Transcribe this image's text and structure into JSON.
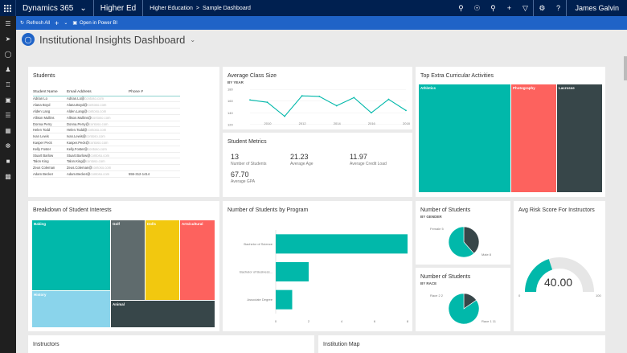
{
  "nav": {
    "brand": "Dynamics 365",
    "app": "Higher Ed",
    "crumb_root": "Higher Education",
    "crumb_sep": ">",
    "crumb_page": "Sample Dashboard",
    "user": "James Galvin"
  },
  "cmd": {
    "refresh": "Refresh All",
    "powerbi": "Open in Power BI"
  },
  "header": {
    "title": "Institutional Insights Dashboard"
  },
  "students": {
    "title": "Students",
    "columns": [
      "Student Name",
      "Email Address",
      "Phone #"
    ],
    "rows": [
      [
        "Adrian Lo",
        "Adrian.Lo@",
        "contoso.com",
        ""
      ],
      [
        "Alana Boyd",
        "Alana.Boyd@",
        "contoso.com",
        ""
      ],
      [
        "Alden Lang",
        "Alden.Lang@",
        "contoso.com",
        ""
      ],
      [
        "Allison Mullins",
        "Allison.Mullins@",
        "contoso.com",
        ""
      ],
      [
        "Donna Perry",
        "Donna.Perry@",
        "contoso.com",
        ""
      ],
      [
        "Helen Todd",
        "Helen.Todd@",
        "contoso.com",
        ""
      ],
      [
        "Ivan Lewis",
        "Ivan.Lewis@",
        "contoso.com",
        ""
      ],
      [
        "Kasper Peck",
        "Kasper.Peck@",
        "contoso.com",
        ""
      ],
      [
        "Kelly Foster",
        "Kelly.Foster@",
        "contoso.com",
        ""
      ],
      [
        "Stuart Barlow",
        "Stuart.Barlow@",
        "contoso.com",
        ""
      ],
      [
        "Talon King",
        "Talon.King@",
        "contoso.com",
        ""
      ],
      [
        "Zeus Coleman",
        "Zeus.Coleman@",
        "contoso.com",
        ""
      ],
      [
        "Adam Becker",
        "Adam.Becker@",
        "contoso.com",
        "555-312-1414"
      ]
    ]
  },
  "class_size": {
    "title": "Average Class Size",
    "subtitle": "BY YEAR"
  },
  "metrics": {
    "title": "Student Metrics",
    "items": [
      {
        "value": "13",
        "label": "Number of Students"
      },
      {
        "value": "21.23",
        "label": "Average Age"
      },
      {
        "value": "11.97",
        "label": "Average Credit Load"
      },
      {
        "value": "67.70",
        "label": "Average GPA"
      }
    ]
  },
  "extracurricular": {
    "title": "Top Extra Curricular Activities",
    "labels": [
      "Athletics",
      "Photography",
      "Lacrosse"
    ]
  },
  "interests": {
    "title": "Breakdown of Student Interests",
    "labels": [
      "Baking",
      "Golf",
      "Dolls",
      "Arts/cultural",
      "History",
      "Animal"
    ]
  },
  "by_gender": {
    "title": "Number of Students",
    "subtitle": "BY GENDER",
    "labels": [
      "Female 5",
      "Male 8"
    ]
  },
  "by_race": {
    "title": "Number of Students",
    "subtitle": "BY RACE",
    "labels": [
      "Race 2 2",
      "Race 1 11"
    ]
  },
  "risk": {
    "title": "Avg Risk Score For Instructors",
    "value": "40.00",
    "min": "0",
    "max": "100",
    "fraction": 0.4
  },
  "instructors": {
    "title": "Instructors"
  },
  "map": {
    "title": "Institution Map"
  },
  "chart_data": [
    {
      "type": "line",
      "title": "Average Class Size",
      "subtitle": "BY YEAR",
      "x": [
        2009,
        2010,
        2011,
        2012,
        2013,
        2014,
        2015,
        2016,
        2017,
        2018
      ],
      "values": [
        162,
        158,
        134,
        169,
        168,
        152,
        166,
        140,
        163,
        144
      ],
      "xticks": [
        "2010",
        "2012",
        "2014",
        "2016",
        "2018"
      ],
      "yticks": [
        "120",
        "140",
        "160",
        "180"
      ],
      "ylim": [
        117,
        183
      ],
      "grid": true
    },
    {
      "type": "bar",
      "orientation": "horizontal",
      "title": "Number of Students by Program",
      "categories": [
        "Bachelor of Science",
        "Bachelor of Business...",
        "Associate Degree"
      ],
      "values": [
        8,
        2,
        1
      ],
      "xticks": [
        "0",
        "2",
        "4",
        "6",
        "8"
      ],
      "xlim": [
        0,
        8
      ]
    },
    {
      "type": "pie",
      "title": "Number of Students",
      "subtitle": "BY GENDER",
      "categories": [
        "Female",
        "Male"
      ],
      "values": [
        5,
        8
      ],
      "colors": [
        "#374649",
        "#01b8aa"
      ]
    },
    {
      "type": "pie",
      "title": "Number of Students",
      "subtitle": "BY RACE",
      "categories": [
        "Race 2",
        "Race 1"
      ],
      "values": [
        2,
        11
      ],
      "colors": [
        "#374649",
        "#01b8aa"
      ]
    }
  ]
}
